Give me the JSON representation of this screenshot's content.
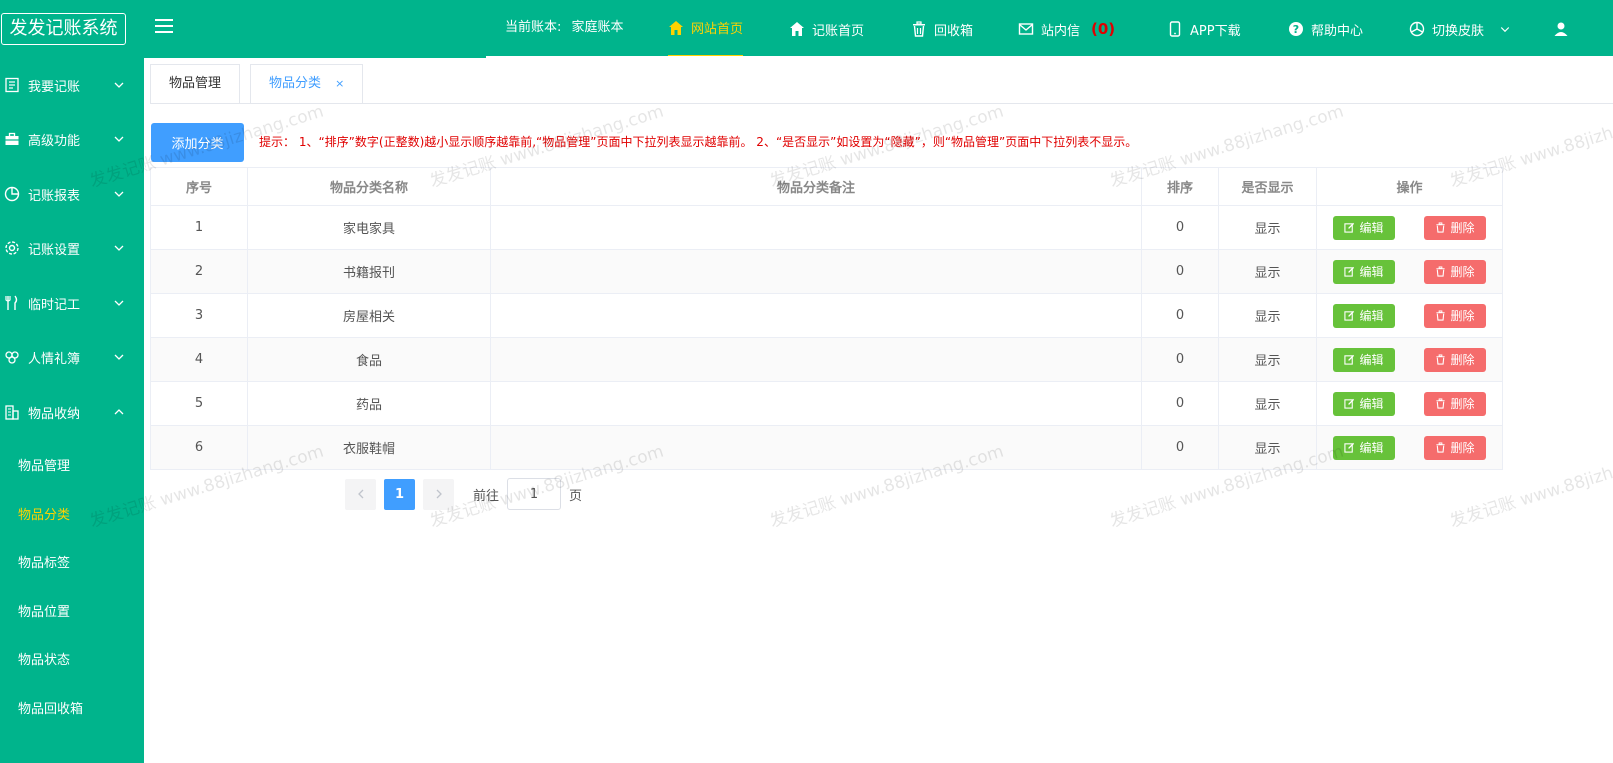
{
  "header": {
    "logo": "发发记账系统",
    "account_label": "当前账本:",
    "account_name": "家庭账本",
    "nav": [
      {
        "label": "网站首页",
        "icon": "home-icon",
        "active": true
      },
      {
        "label": "记账首页",
        "icon": "home-icon"
      },
      {
        "label": "回收箱",
        "icon": "trash-icon"
      },
      {
        "label": "站内信",
        "icon": "mail-icon",
        "count": "(0)"
      },
      {
        "label": "APP下载",
        "icon": "phone-icon"
      },
      {
        "label": "帮助中心",
        "icon": "help-icon"
      },
      {
        "label": "切换皮肤",
        "icon": "palette-icon"
      }
    ]
  },
  "sidebar": {
    "groups": [
      {
        "label": "我要记账",
        "icon": "ledger-icon"
      },
      {
        "label": "高级功能",
        "icon": "briefcase-icon"
      },
      {
        "label": "记账报表",
        "icon": "pie-chart-icon"
      },
      {
        "label": "记账设置",
        "icon": "gear-icon"
      },
      {
        "label": "临时记工",
        "icon": "fork-knife-icon"
      },
      {
        "label": "人情礼簿",
        "icon": "gift-icon"
      },
      {
        "label": "物品收纳",
        "icon": "building-icon",
        "expanded": true
      }
    ],
    "sub_items": [
      {
        "label": "物品管理"
      },
      {
        "label": "物品分类",
        "active": true
      },
      {
        "label": "物品标签"
      },
      {
        "label": "物品位置"
      },
      {
        "label": "物品状态"
      },
      {
        "label": "物品回收箱"
      }
    ]
  },
  "tabs": [
    {
      "label": "物品管理"
    },
    {
      "label": "物品分类",
      "active": true,
      "close": "×"
    }
  ],
  "toolbar": {
    "add_label": "添加分类",
    "tip": "提示： 1、“排序”数字(正整数)越小显示顺序越靠前,“物品管理”页面中下拉列表显示越靠前。 2、“是否显示”如设置为“隐藏”，则“物品管理”页面中下拉列表不显示。"
  },
  "table": {
    "headers": [
      "序号",
      "物品分类名称",
      "物品分类备注",
      "排序",
      "是否显示",
      "操作"
    ],
    "edit_label": "编辑",
    "delete_label": "删除",
    "rows": [
      {
        "no": "1",
        "name": "家电家具",
        "note": "",
        "sort": "0",
        "show": "显示"
      },
      {
        "no": "2",
        "name": "书籍报刊",
        "note": "",
        "sort": "0",
        "show": "显示"
      },
      {
        "no": "3",
        "name": "房屋相关",
        "note": "",
        "sort": "0",
        "show": "显示"
      },
      {
        "no": "4",
        "name": "食品",
        "note": "",
        "sort": "0",
        "show": "显示"
      },
      {
        "no": "5",
        "name": "药品",
        "note": "",
        "sort": "0",
        "show": "显示"
      },
      {
        "no": "6",
        "name": "衣服鞋帽",
        "note": "",
        "sort": "0",
        "show": "显示"
      }
    ]
  },
  "pager": {
    "current": "1",
    "goto_label": "前往",
    "goto_value": "1",
    "page_unit": "页"
  },
  "watermark": "发发记账 www.88jizhang.com",
  "colors": {
    "primary": "#00b48c",
    "active_nav": "#ffd200",
    "blue": "#409eff",
    "edit": "#67c23a",
    "delete": "#f56c6c",
    "tip": "#e00000"
  }
}
